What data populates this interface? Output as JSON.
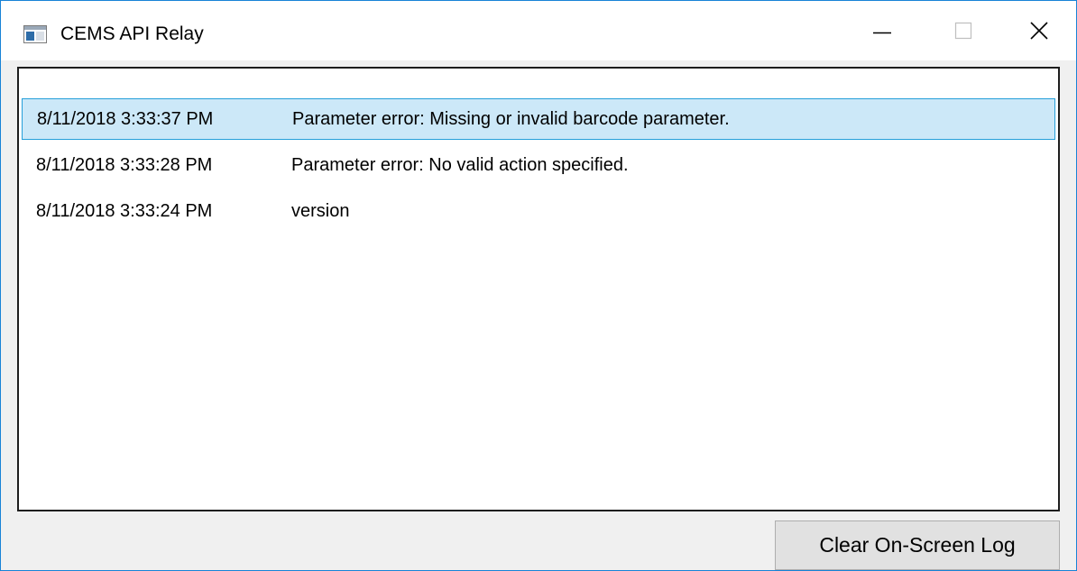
{
  "window": {
    "title": "CEMS API Relay",
    "accent_color": "#1883d7"
  },
  "caption_buttons": {
    "minimize_icon": "minimize-icon",
    "maximize_icon": "maximize-icon",
    "close_icon": "close-icon"
  },
  "log": {
    "selection_color": "#cce8f8",
    "selection_border_color": "#26a0da",
    "entries": [
      {
        "timestamp": "8/11/2018 3:33:37 PM",
        "message": "Parameter error: Missing or invalid barcode parameter.",
        "selected": true
      },
      {
        "timestamp": "8/11/2018 3:33:28 PM",
        "message": "Parameter error: No valid action specified.",
        "selected": false
      },
      {
        "timestamp": "8/11/2018 3:33:24 PM",
        "message": "version",
        "selected": false
      }
    ]
  },
  "actions": {
    "clear_label": "Clear On-Screen Log"
  }
}
